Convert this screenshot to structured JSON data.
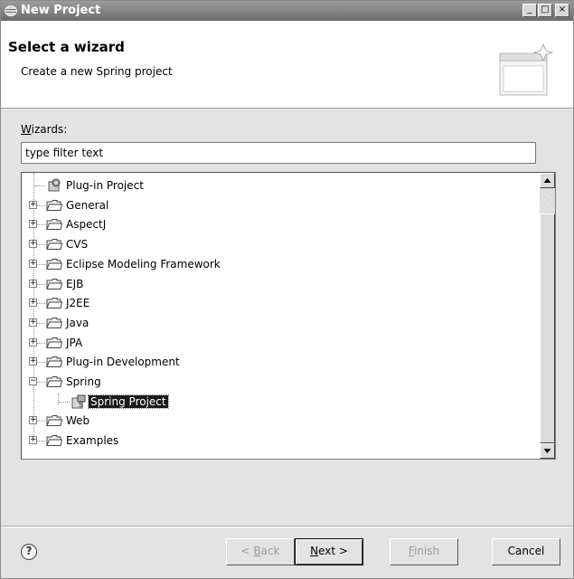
{
  "window": {
    "title": "New Project",
    "controls": {
      "minimize": "_",
      "maximize": "□",
      "close": "×"
    }
  },
  "header": {
    "title": "Select a wizard",
    "subtitle": "Create a new Spring project"
  },
  "wizards": {
    "label_mnemonic": "W",
    "label_rest": "izards:",
    "filter_value": "type filter text"
  },
  "tree": {
    "items": [
      {
        "label": "Plug-in Project",
        "kind": "project",
        "depth": 0,
        "expander": ""
      },
      {
        "label": "General",
        "kind": "folder",
        "depth": 0,
        "expander": "+"
      },
      {
        "label": "AspectJ",
        "kind": "folder",
        "depth": 0,
        "expander": "+"
      },
      {
        "label": "CVS",
        "kind": "folder",
        "depth": 0,
        "expander": "+"
      },
      {
        "label": "Eclipse Modeling Framework",
        "kind": "folder",
        "depth": 0,
        "expander": "+"
      },
      {
        "label": "EJB",
        "kind": "folder",
        "depth": 0,
        "expander": "+"
      },
      {
        "label": "J2EE",
        "kind": "folder",
        "depth": 0,
        "expander": "+"
      },
      {
        "label": "Java",
        "kind": "folder",
        "depth": 0,
        "expander": "+"
      },
      {
        "label": "JPA",
        "kind": "folder",
        "depth": 0,
        "expander": "+"
      },
      {
        "label": "Plug-in Development",
        "kind": "folder",
        "depth": 0,
        "expander": "+"
      },
      {
        "label": "Spring",
        "kind": "folder",
        "depth": 0,
        "expander": "−"
      },
      {
        "label": "Spring Project",
        "kind": "spring-project",
        "depth": 1,
        "expander": "",
        "selected": true
      },
      {
        "label": "Web",
        "kind": "folder",
        "depth": 0,
        "expander": "+"
      },
      {
        "label": "Examples",
        "kind": "folder",
        "depth": 0,
        "expander": "+"
      }
    ]
  },
  "buttons": {
    "help": "?",
    "back_prefix": "< ",
    "back_mnemonic": "B",
    "back_rest": "ack",
    "next_mnemonic": "N",
    "next_rest": "ext >",
    "finish_mnemonic": "F",
    "finish_rest": "inish",
    "cancel": "Cancel"
  },
  "colors": {
    "selection_bg": "#1a1a1a",
    "selection_fg": "#ffffff",
    "disabled_text": "#9a9a9a"
  }
}
